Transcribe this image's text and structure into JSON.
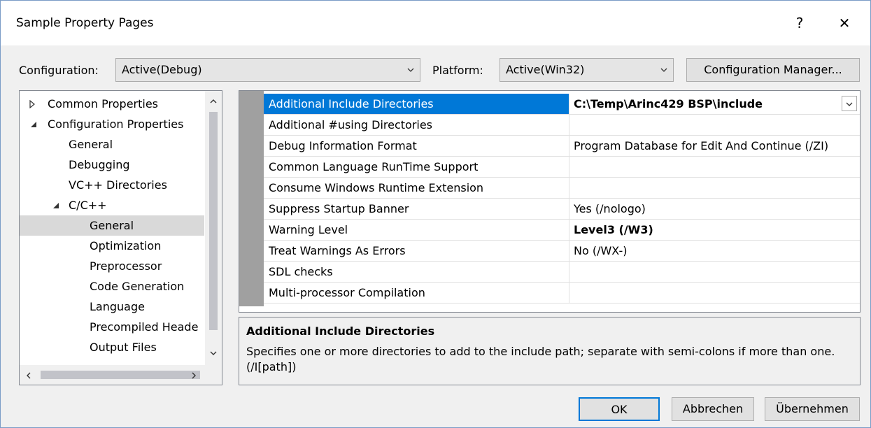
{
  "window": {
    "title": "Sample Property Pages",
    "help_label": "?",
    "close_label": "✕"
  },
  "config": {
    "configuration_label": "Configuration:",
    "configuration_value": "Active(Debug)",
    "platform_label": "Platform:",
    "platform_value": "Active(Win32)",
    "manager_button": "Configuration Manager..."
  },
  "tree": {
    "items": [
      {
        "label": "Common Properties"
      },
      {
        "label": "Configuration Properties"
      },
      {
        "label": "General"
      },
      {
        "label": "Debugging"
      },
      {
        "label": "VC++ Directories"
      },
      {
        "label": "C/C++"
      },
      {
        "label": "General"
      },
      {
        "label": "Optimization"
      },
      {
        "label": "Preprocessor"
      },
      {
        "label": "Code Generation"
      },
      {
        "label": "Language"
      },
      {
        "label": "Precompiled Heade"
      },
      {
        "label": "Output Files"
      }
    ],
    "selected_index": 6
  },
  "grid": {
    "rows": [
      {
        "name": "Additional Include Directories",
        "value": "C:\\Temp\\Arinc429 BSP\\include"
      },
      {
        "name": "Additional #using Directories",
        "value": ""
      },
      {
        "name": "Debug Information Format",
        "value": "Program Database for Edit And Continue (/ZI)"
      },
      {
        "name": "Common Language RunTime Support",
        "value": ""
      },
      {
        "name": "Consume Windows Runtime Extension",
        "value": ""
      },
      {
        "name": "Suppress Startup Banner",
        "value": "Yes (/nologo)"
      },
      {
        "name": "Warning Level",
        "value": "Level3 (/W3)"
      },
      {
        "name": "Treat Warnings As Errors",
        "value": "No (/WX-)"
      },
      {
        "name": "SDL checks",
        "value": ""
      },
      {
        "name": "Multi-processor Compilation",
        "value": ""
      }
    ]
  },
  "description": {
    "title": "Additional Include Directories",
    "text": "Specifies one or more directories to add to the include path; separate with semi-colons if more than one.     (/I[path])"
  },
  "buttons": {
    "ok": "OK",
    "cancel": "Abbrechen",
    "apply": "Übernehmen"
  },
  "colors": {
    "selection": "#0078d7",
    "tree_selection": "#d9d9d9",
    "gutter": "#a0a0a0"
  }
}
